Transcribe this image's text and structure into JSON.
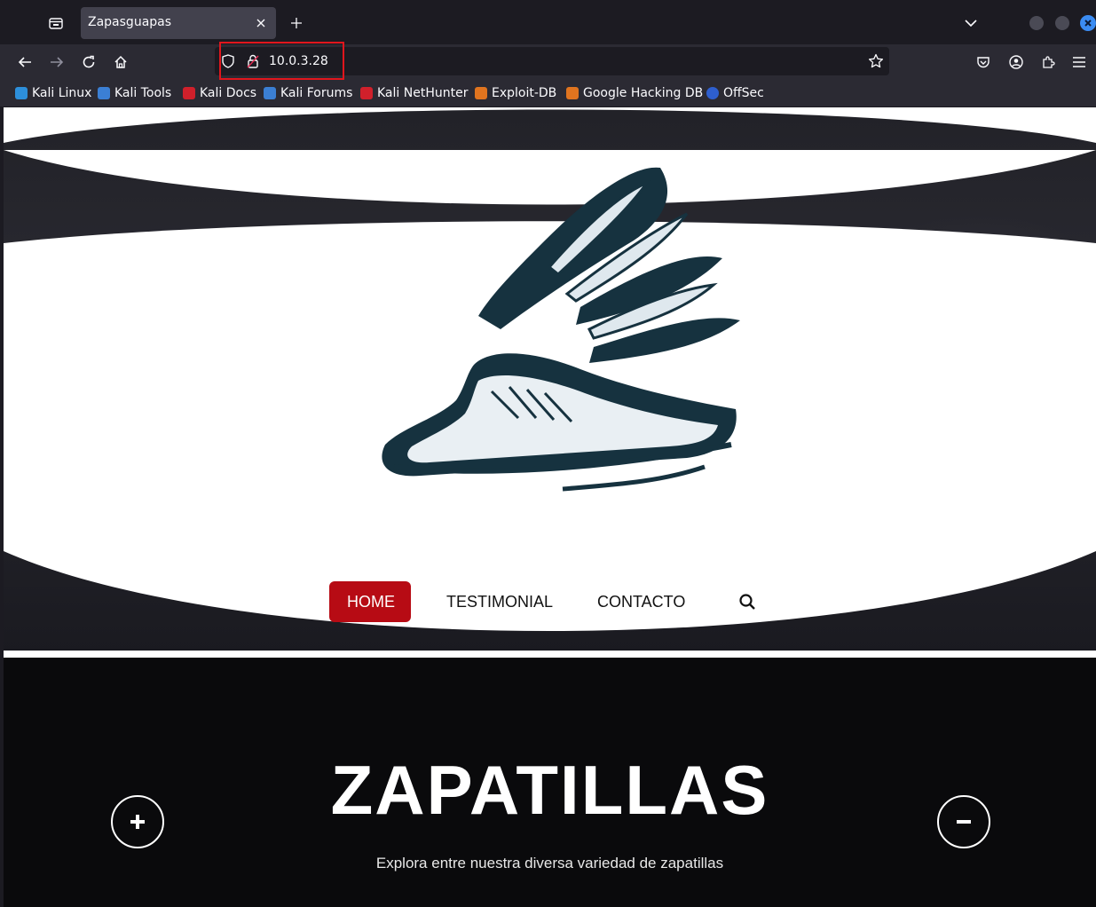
{
  "browser": {
    "tab_title": "Zapasguapas",
    "url": "10.0.3.28",
    "bookmarks": [
      {
        "label": "Kali Linux",
        "color": "#2d8fdb"
      },
      {
        "label": "Kali Tools",
        "color": "#3b7fd4"
      },
      {
        "label": "Kali Docs",
        "color": "#d0202b"
      },
      {
        "label": "Kali Forums",
        "color": "#3b7fd4"
      },
      {
        "label": "Kali NetHunter",
        "color": "#d0202b"
      },
      {
        "label": "Exploit-DB",
        "color": "#e0741f"
      },
      {
        "label": "Google Hacking DB",
        "color": "#e0741f"
      },
      {
        "label": "OffSec",
        "color": "#2e5fcf"
      }
    ]
  },
  "site": {
    "nav": [
      {
        "label": "HOME",
        "active": true
      },
      {
        "label": "TESTIMONIAL",
        "active": false
      },
      {
        "label": "CONTACTO",
        "active": false
      }
    ],
    "hero_title": "ZAPATILLAS",
    "hero_subtitle": "Explora entre nuestra diversa variedad de zapatillas",
    "accent_color": "#b70b14",
    "logo_color": "#16323f"
  }
}
